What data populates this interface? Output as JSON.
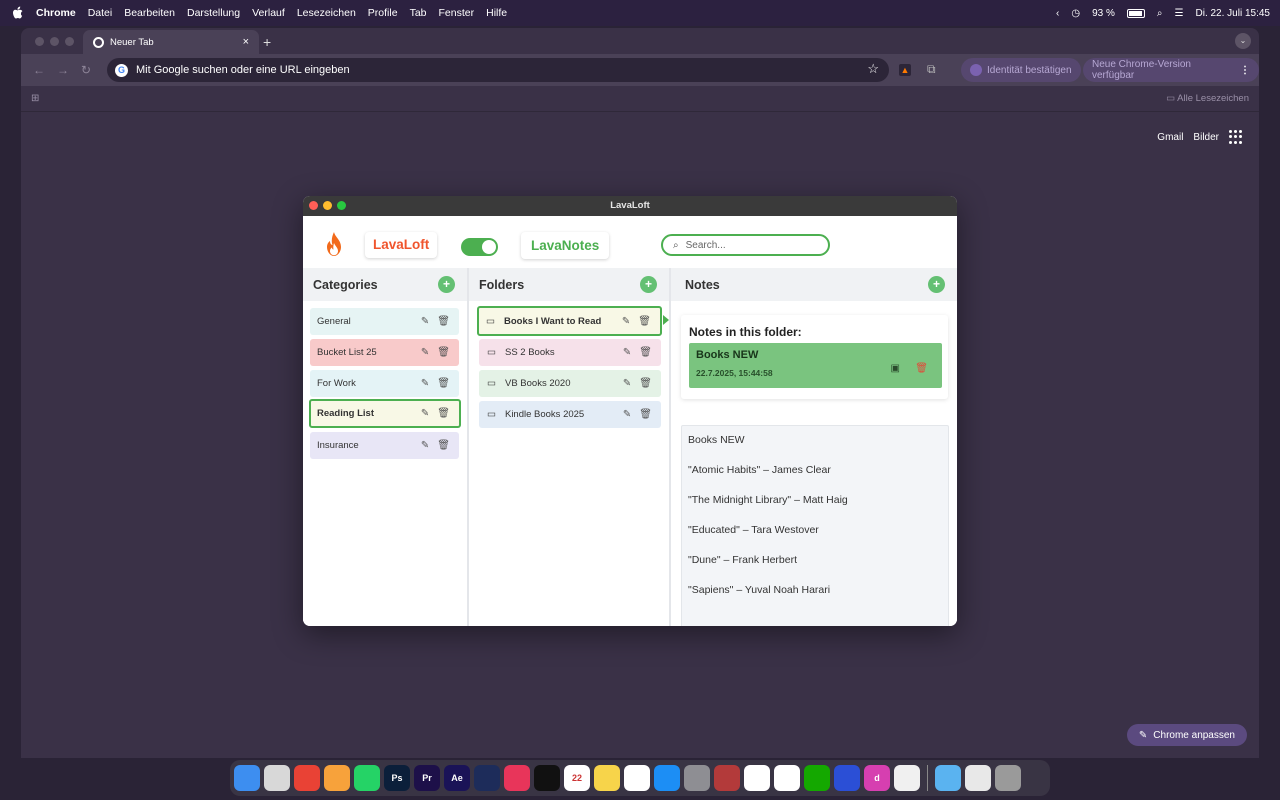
{
  "menubar": {
    "app": "Chrome",
    "items": [
      "Datei",
      "Bearbeiten",
      "Darstellung",
      "Verlauf",
      "Lesezeichen",
      "Profile",
      "Tab",
      "Fenster",
      "Hilfe"
    ],
    "battery": "93 %",
    "datetime": "Di. 22. Juli 15:45"
  },
  "browser": {
    "tab_title": "Neuer Tab",
    "omnibox": "Mit Google suchen oder eine URL eingeben",
    "identity_btn": "Identität bestätigen",
    "update_btn": "Neue Chrome-Version verfügbar",
    "all_bookmarks": "Alle Lesezeichen",
    "gmail": "Gmail",
    "images": "Bilder",
    "customize": "Chrome anpassen"
  },
  "app": {
    "window_title": "LavaLoft",
    "brand": "LavaLoft",
    "brand2": "LavaNotes",
    "search_placeholder": "Search...",
    "toggle_on": true
  },
  "categories": {
    "title": "Categories",
    "items": [
      {
        "label": "General",
        "color": "#e6f4f4",
        "selected": false
      },
      {
        "label": "Bucket List 25",
        "color": "#f8caca",
        "selected": false
      },
      {
        "label": "For Work",
        "color": "#e4f3f6",
        "selected": false
      },
      {
        "label": "Reading List",
        "color": "#f8f8e6",
        "selected": true
      },
      {
        "label": "Insurance",
        "color": "#e8e6f6",
        "selected": false
      }
    ]
  },
  "folders": {
    "title": "Folders",
    "items": [
      {
        "label": "Books I Want to Read",
        "color": "#f8f8e6",
        "selected": true
      },
      {
        "label": "SS 2 Books",
        "color": "#f6e1ea",
        "selected": false
      },
      {
        "label": "VB Books 2020",
        "color": "#e4f2e6",
        "selected": false
      },
      {
        "label": "Kindle Books 2025",
        "color": "#e3ecf6",
        "selected": false
      }
    ]
  },
  "notes": {
    "title": "Notes",
    "in_folder": "Notes in this folder:",
    "card": {
      "title": "Books NEW",
      "date": "22.7.2025, 15:44:58"
    },
    "content": [
      "Books NEW",
      "\"Atomic Habits\" – James Clear",
      "\"The Midnight Library\" – Matt Haig",
      "\"Educated\" – Tara Westover",
      "\"Dune\" – Frank Herbert",
      "\"Sapiens\" – Yuval Noah Harari"
    ]
  },
  "colors": {
    "accent_green": "#4caf50",
    "brand_orange": "#f0552d",
    "selected_border": "#4caf50"
  },
  "dock": {
    "apps": [
      {
        "name": "finder-icon",
        "text": "",
        "bg": "#3d8ef0"
      },
      {
        "name": "launchpad-icon",
        "text": "",
        "bg": "#d8d8d8"
      },
      {
        "name": "chrome-icon",
        "text": "",
        "bg": "#e94235"
      },
      {
        "name": "photos-icon",
        "text": "",
        "bg": "#f7a23b"
      },
      {
        "name": "whatsapp-icon",
        "text": "",
        "bg": "#25d366"
      },
      {
        "name": "photoshop-icon",
        "text": "Ps",
        "bg": "#0b1f3a"
      },
      {
        "name": "premiere-icon",
        "text": "Pr",
        "bg": "#1d1049"
      },
      {
        "name": "aftereffects-icon",
        "text": "Ae",
        "bg": "#1a1357"
      },
      {
        "name": "cinema4d-icon",
        "text": "",
        "bg": "#1d2c5a"
      },
      {
        "name": "creative-cloud-icon",
        "text": "",
        "bg": "#e8355a"
      },
      {
        "name": "capcut-icon",
        "text": "",
        "bg": "#111111"
      },
      {
        "name": "calendar-icon",
        "text": "22",
        "bg": "#ffffff"
      },
      {
        "name": "notes-icon",
        "text": "",
        "bg": "#f7d44a"
      },
      {
        "name": "freeform-icon",
        "text": "",
        "bg": "#ffffff"
      },
      {
        "name": "appstore-icon",
        "text": "",
        "bg": "#1c8ef5"
      },
      {
        "name": "settings-icon",
        "text": "",
        "bg": "#8e8e93"
      },
      {
        "name": "pdf-icon",
        "text": "",
        "bg": "#b33a3a"
      },
      {
        "name": "player-icon",
        "text": "",
        "bg": "#ffffff"
      },
      {
        "name": "list-icon",
        "text": "",
        "bg": "#ffffff"
      },
      {
        "name": "upwork-icon",
        "text": "",
        "bg": "#14a800"
      },
      {
        "name": "webex-icon",
        "text": "",
        "bg": "#2b4fd6"
      },
      {
        "name": "studio-icon",
        "text": "d",
        "bg": "#d63fb0"
      },
      {
        "name": "script-icon",
        "text": "",
        "bg": "#f0f0f0"
      },
      {
        "name": "sep",
        "text": "",
        "bg": ""
      },
      {
        "name": "folder-icon",
        "text": "",
        "bg": "#5ab3f0"
      },
      {
        "name": "preview-icon",
        "text": "",
        "bg": "#e8e8e8"
      },
      {
        "name": "trash-icon",
        "text": "",
        "bg": "#9a9a9a"
      }
    ]
  }
}
